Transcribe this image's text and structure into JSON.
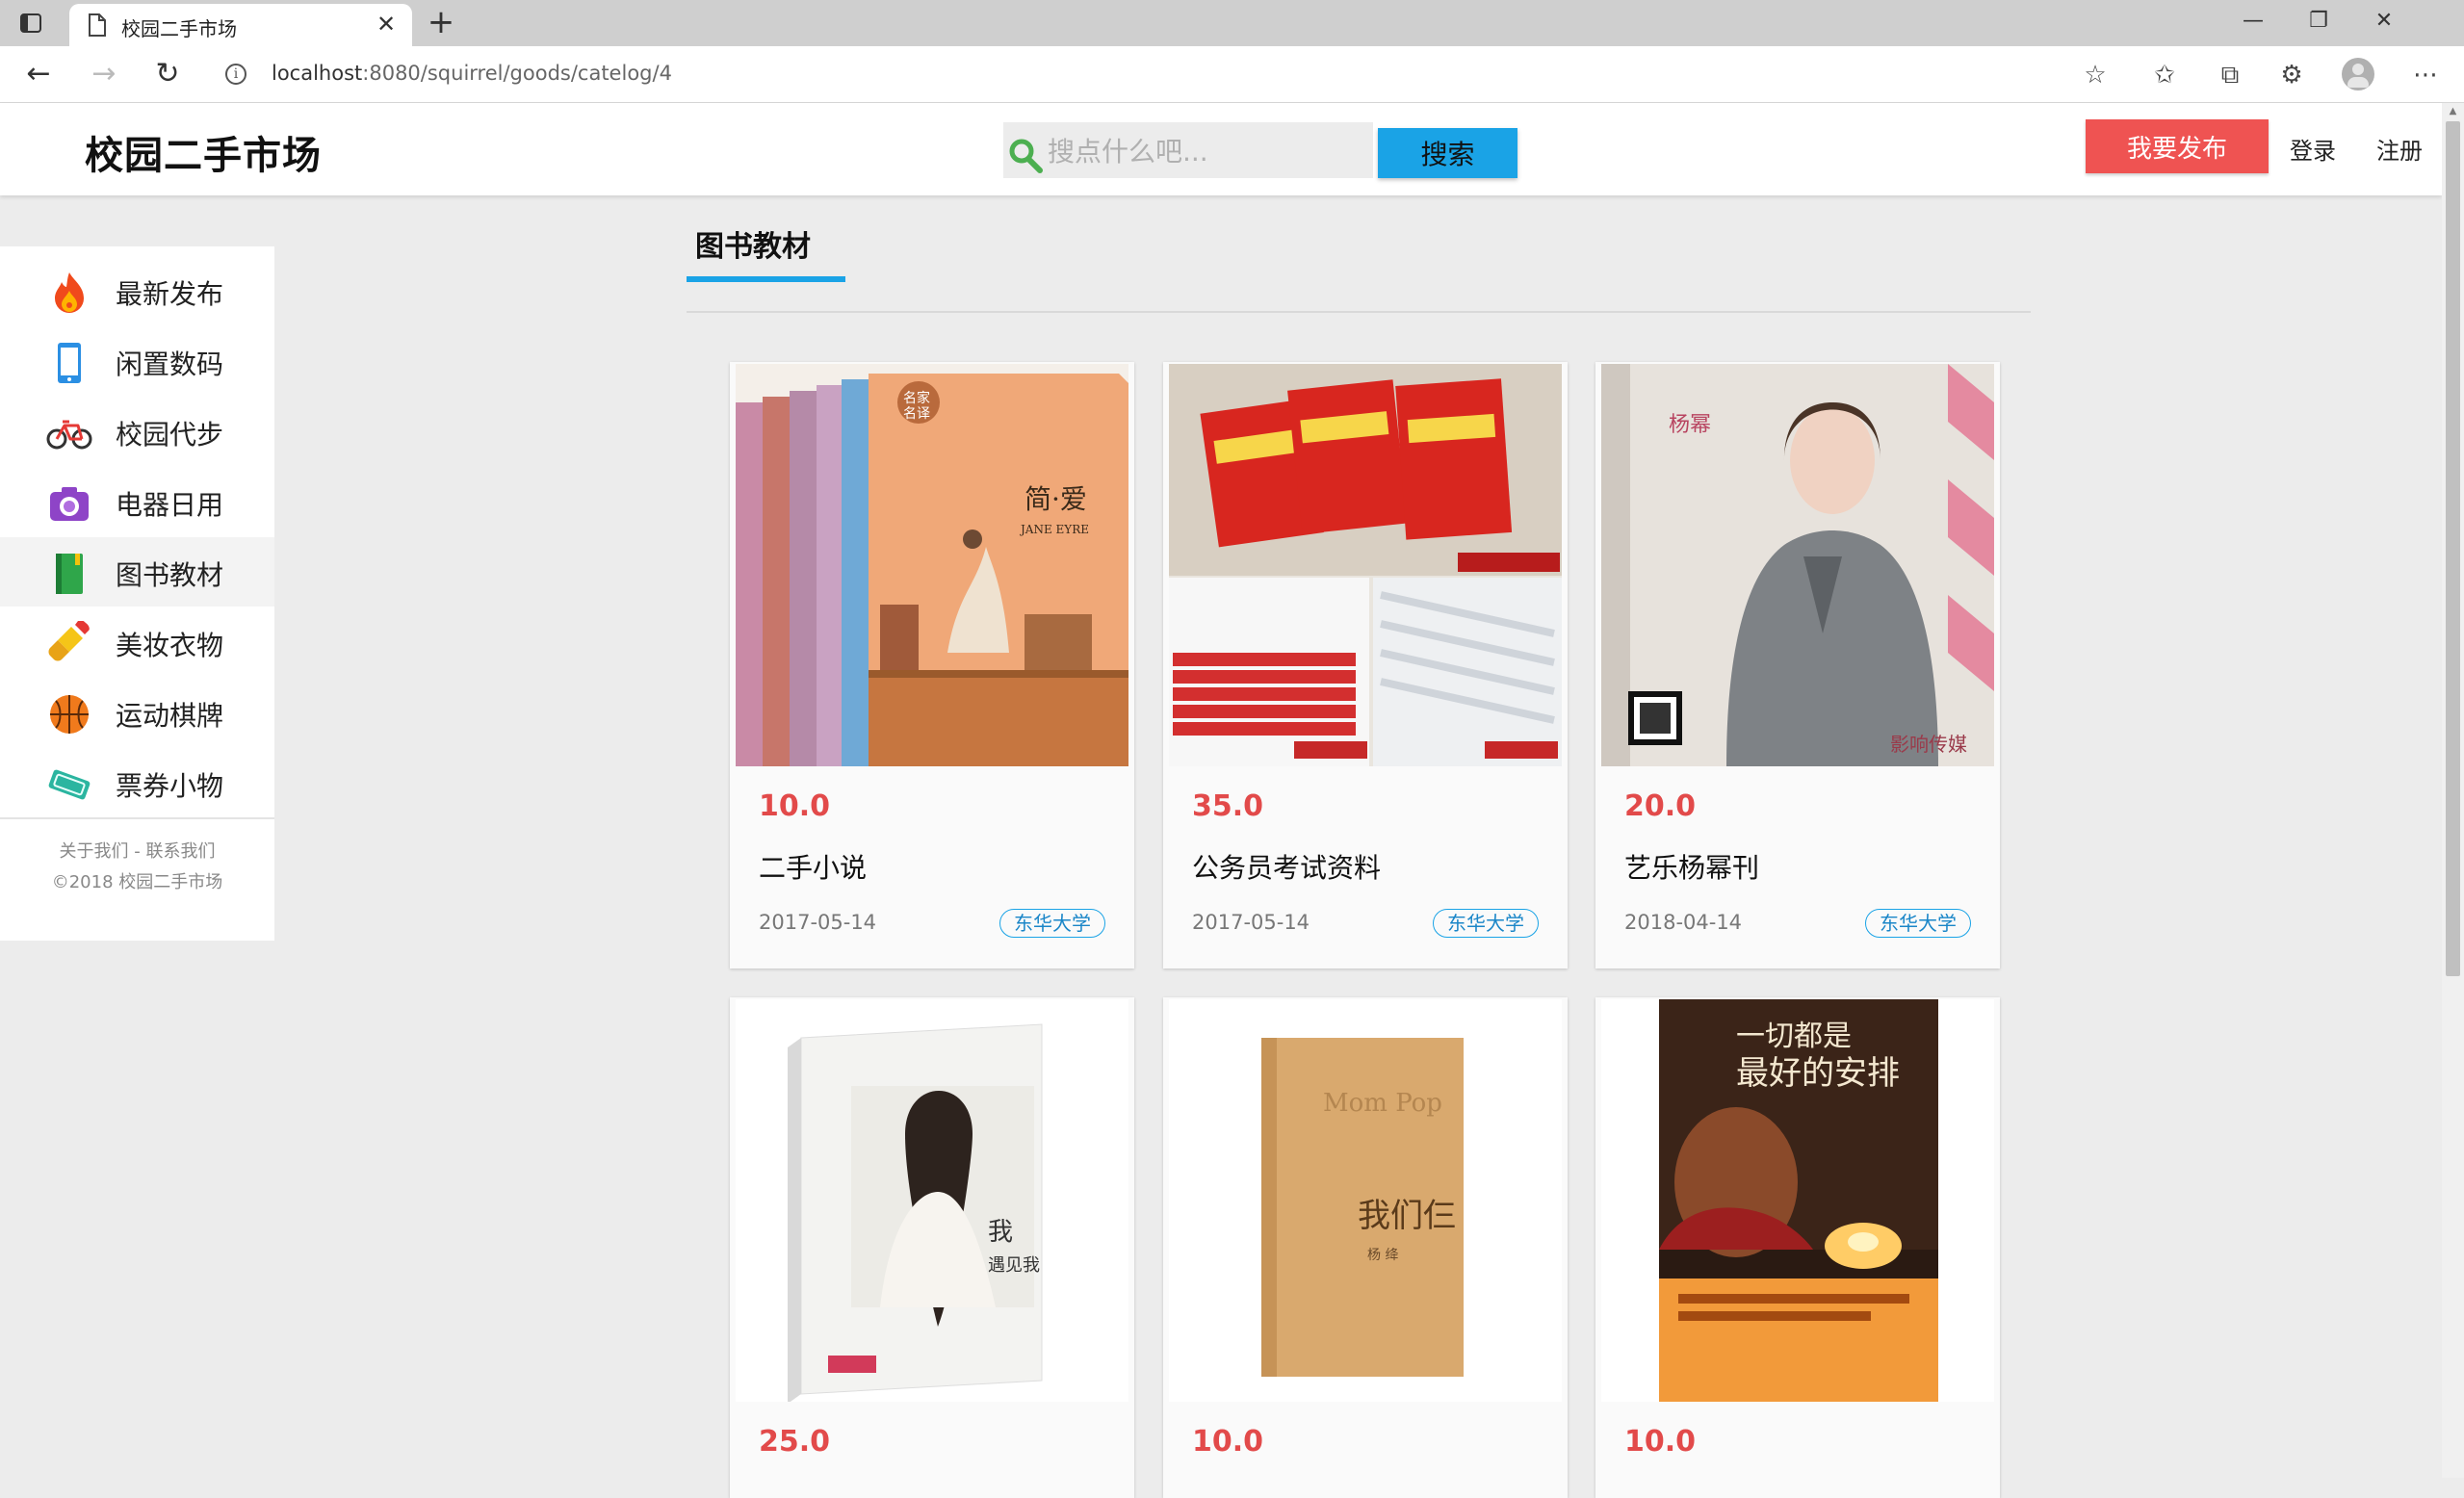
{
  "browser": {
    "tab_title": "校园二手市场",
    "url_host": "localhost",
    "url_path": ":8080/squirrel/goods/catelog/4"
  },
  "header": {
    "logo": "校园二手市场",
    "search_placeholder": "搜点什么吧...",
    "search_button": "搜索",
    "publish_button": "我要发布",
    "login": "登录",
    "register": "注册"
  },
  "sidebar": {
    "items": [
      {
        "label": "最新发布",
        "icon": "flame-icon"
      },
      {
        "label": "闲置数码",
        "icon": "phone-icon"
      },
      {
        "label": "校园代步",
        "icon": "bicycle-icon"
      },
      {
        "label": "电器日用",
        "icon": "camera-icon"
      },
      {
        "label": "图书教材",
        "icon": "book-icon",
        "active": true
      },
      {
        "label": "美妆衣物",
        "icon": "lipstick-icon"
      },
      {
        "label": "运动棋牌",
        "icon": "basketball-icon"
      },
      {
        "label": "票券小物",
        "icon": "ticket-icon"
      }
    ],
    "footer_links": "关于我们 - 联系我们",
    "copyright": "©2018 校园二手市场"
  },
  "category": {
    "title": "图书教材"
  },
  "goods": [
    {
      "price": "10.0",
      "name": "二手小说",
      "date": "2017-05-14",
      "school": "东华大学"
    },
    {
      "price": "35.0",
      "name": "公务员考试资料",
      "date": "2017-05-14",
      "school": "东华大学"
    },
    {
      "price": "20.0",
      "name": "艺乐杨幂刊",
      "date": "2018-04-14",
      "school": "东华大学"
    },
    {
      "price": "25.0"
    },
    {
      "price": "10.0"
    },
    {
      "price": "10.0"
    }
  ],
  "colors": {
    "accent_blue": "#1aa3e6",
    "publish_red": "#ef5352",
    "price_red": "#e24a4a",
    "page_bg": "#ececec"
  }
}
